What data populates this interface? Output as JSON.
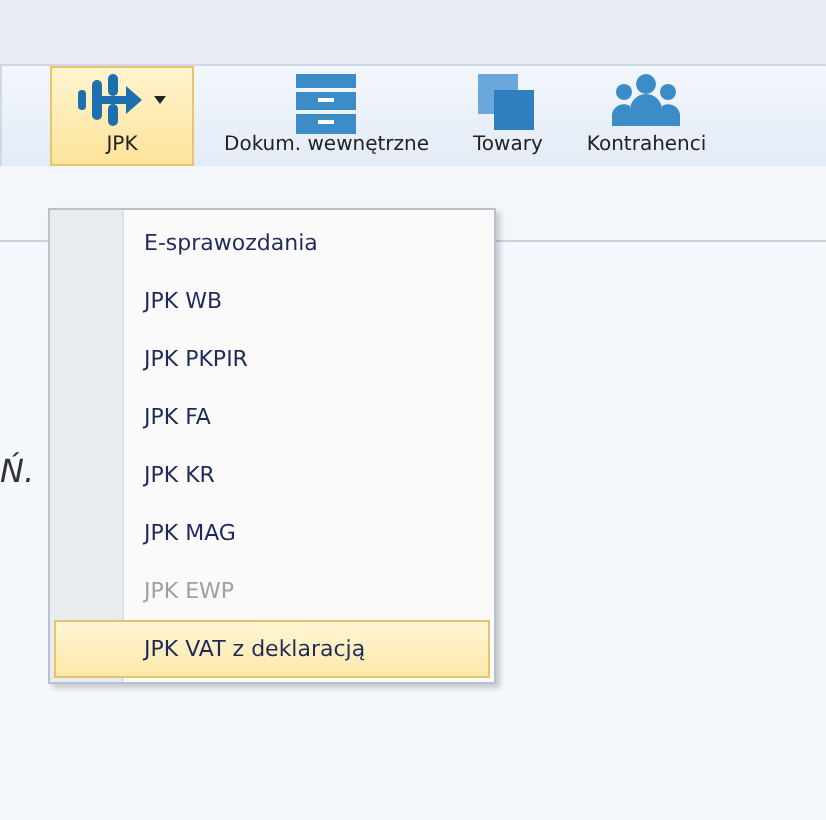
{
  "toolbar": {
    "buttons": [
      {
        "label": "JPK",
        "selected": true,
        "dropdown": true
      },
      {
        "label": "Dokum. wewnętrzne",
        "selected": false,
        "dropdown": false
      },
      {
        "label": "Towary",
        "selected": false,
        "dropdown": false
      },
      {
        "label": "Kontrahenci",
        "selected": false,
        "dropdown": false
      }
    ]
  },
  "background_text": "Ń.",
  "menu": {
    "items": [
      {
        "label": "E-sprawozdania",
        "disabled": false,
        "selected": false
      },
      {
        "label": "JPK WB",
        "disabled": false,
        "selected": false
      },
      {
        "label": "JPK PKPIR",
        "disabled": false,
        "selected": false
      },
      {
        "label": "JPK FA",
        "disabled": false,
        "selected": false
      },
      {
        "label": "JPK KR",
        "disabled": false,
        "selected": false
      },
      {
        "label": "JPK MAG",
        "disabled": false,
        "selected": false
      },
      {
        "label": "JPK EWP",
        "disabled": true,
        "selected": false
      },
      {
        "label": "JPK VAT z deklaracją",
        "disabled": false,
        "selected": true
      }
    ]
  }
}
